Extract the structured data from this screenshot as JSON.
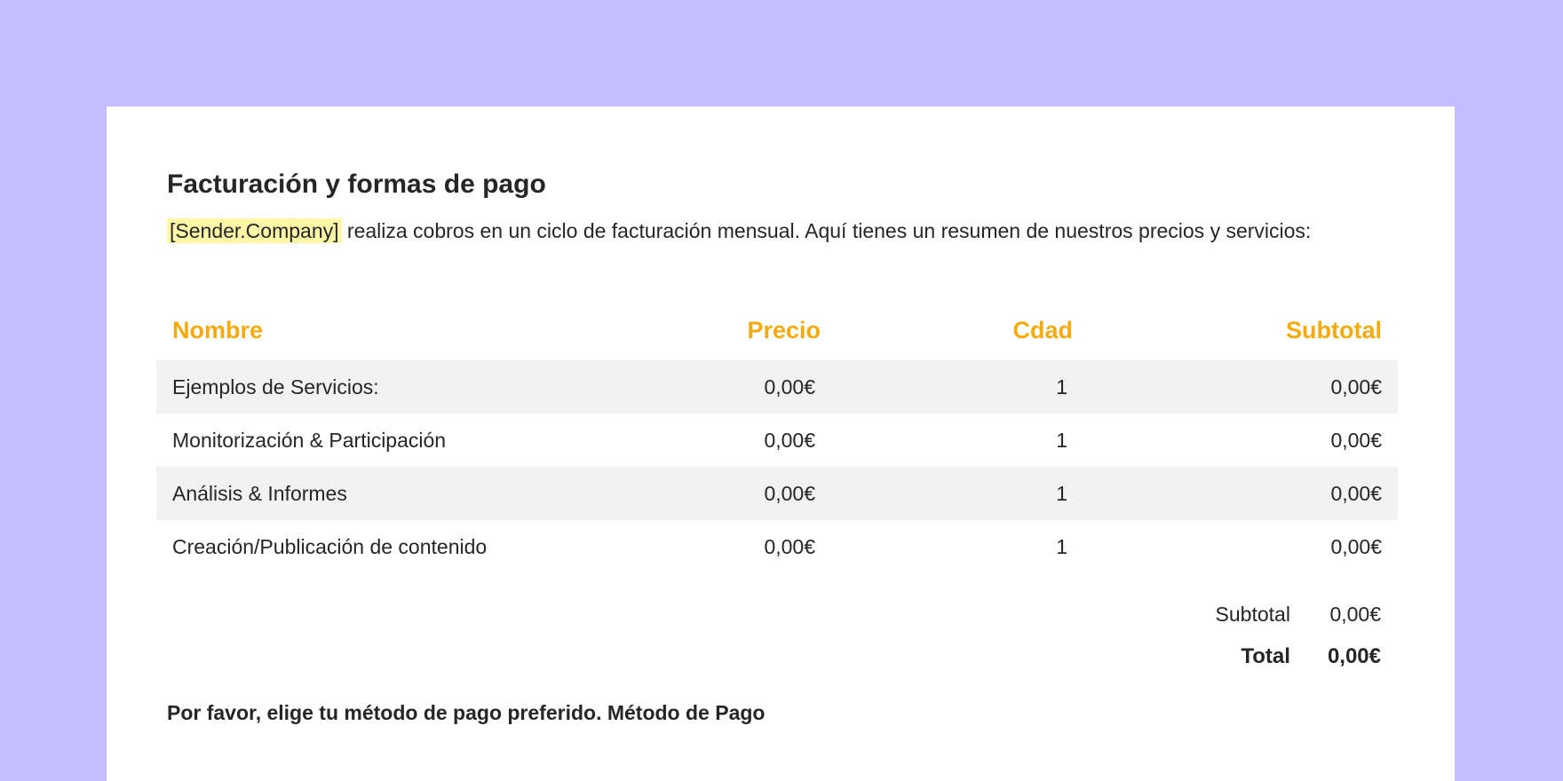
{
  "document": {
    "title": "Facturación y formas de pago",
    "intro_placeholder": "[Sender.Company]",
    "intro_text": " realiza cobros en un ciclo de facturación mensual. Aquí tienes un resumen de nuestros precios y servicios:",
    "table": {
      "headers": {
        "name": "Nombre",
        "price": "Precio",
        "qty": "Cdad",
        "subtotal": "Subtotal"
      },
      "rows": [
        {
          "name": "Ejemplos de Servicios:",
          "price": "0,00€",
          "qty": "1",
          "subtotal": "0,00€"
        },
        {
          "name": "Monitorización & Participación",
          "price": "0,00€",
          "qty": "1",
          "subtotal": "0,00€"
        },
        {
          "name": "Análisis & Informes",
          "price": "0,00€",
          "qty": "1",
          "subtotal": "0,00€"
        },
        {
          "name": "Creación/Publicación de contenido",
          "price": "0,00€",
          "qty": "1",
          "subtotal": "0,00€"
        }
      ]
    },
    "totals": {
      "subtotal_label": "Subtotal",
      "subtotal_value": "0,00€",
      "total_label": "Total",
      "total_value": "0,00€"
    },
    "payment_note": "Por favor, elige tu método de pago preferido. Método de Pago"
  },
  "colors": {
    "background": "#c5bdff",
    "header_accent": "#f5ab0f",
    "placeholder_highlight": "#fff7a8",
    "row_stripe": "#f2f2f2"
  }
}
